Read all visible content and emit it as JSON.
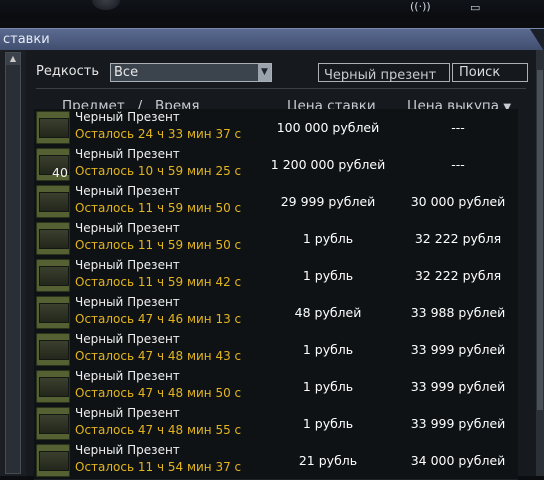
{
  "window": {
    "title": "ставки"
  },
  "filter": {
    "label": "Редкость",
    "rarity_value": "Все",
    "search_value": "Черный презент",
    "search_button": "Поиск"
  },
  "table": {
    "headers": {
      "item": "Предмет",
      "sep": "/",
      "time": "Время",
      "bid_price": "Цена ставки",
      "buyout_price": "Цена выкупа",
      "sort_arrow": "▼"
    },
    "rows": [
      {
        "qty": "",
        "name": "Черный Презент",
        "time": "Осталось 24 ч 33 мин 37 с",
        "bid": "100 000 рублей",
        "buyout": "---"
      },
      {
        "qty": "40",
        "name": "Черный Презент",
        "time": "Осталось 10 ч 59 мин 25 с",
        "bid": "1 200 000 рублей",
        "buyout": "---"
      },
      {
        "qty": "",
        "name": "Черный Презент",
        "time": "Осталось 11 ч 59 мин 50 с",
        "bid": "29 999 рублей",
        "buyout": "30 000 рублей"
      },
      {
        "qty": "",
        "name": "Черный Презент",
        "time": "Осталось 11 ч 59 мин 50 с",
        "bid": "1 рубль",
        "buyout": "32 222 рубля"
      },
      {
        "qty": "",
        "name": "Черный Презент",
        "time": "Осталось 11 ч 59 мин 42 с",
        "bid": "1 рубль",
        "buyout": "32 222 рубля"
      },
      {
        "qty": "",
        "name": "Черный Презент",
        "time": "Осталось 47 ч 46 мин 13 с",
        "bid": "48 рублей",
        "buyout": "33 988 рублей"
      },
      {
        "qty": "",
        "name": "Черный Презент",
        "time": "Осталось 47 ч 48 мин 43 с",
        "bid": "1 рубль",
        "buyout": "33 999 рублей"
      },
      {
        "qty": "",
        "name": "Черный Презент",
        "time": "Осталось 47 ч 48 мин 50 с",
        "bid": "1 рубль",
        "buyout": "33 999 рублей"
      },
      {
        "qty": "",
        "name": "Черный Презент",
        "time": "Осталось 47 ч 48 мин 55 с",
        "bid": "1 рубль",
        "buyout": "33 999 рублей"
      },
      {
        "qty": "",
        "name": "Черный Презент",
        "time": "Осталось 11 ч 54 мин 37 с",
        "bid": "21 рубль",
        "buyout": "34 000 рублей"
      }
    ]
  },
  "colors": {
    "time_text": "#e3b51f",
    "titlebar": "#4a5a80",
    "row_bg": "#0f1215"
  },
  "icons": {
    "item": "black-gift-box-icon",
    "wifi": "wifi-icon",
    "battery": "battery-icon",
    "scroll_up": "scroll-up-arrow-icon",
    "dropdown": "dropdown-arrow-icon"
  }
}
